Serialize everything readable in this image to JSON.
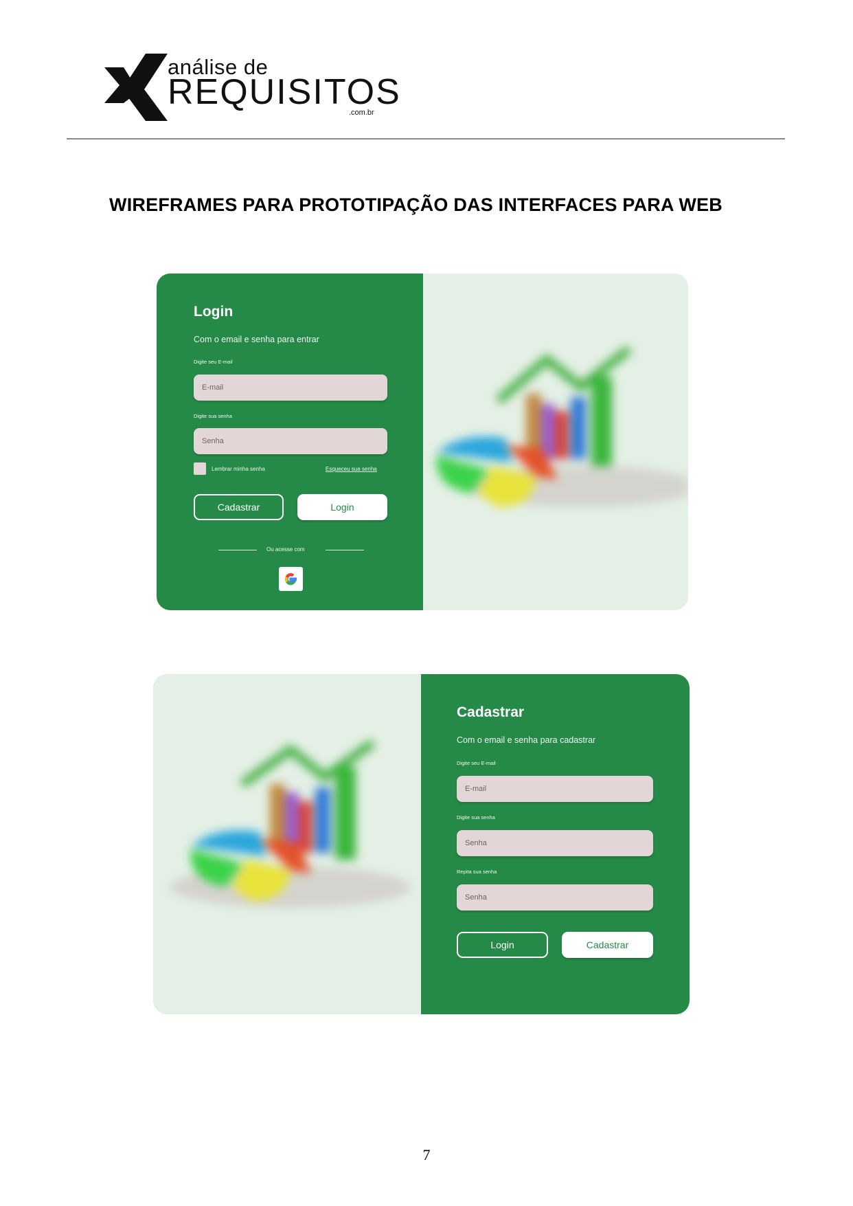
{
  "header": {
    "logo_top": "análise de",
    "logo_main": "REQUISITOS",
    "logo_sub": ".com.br",
    "logo_icon": "x-chevron-logo-icon"
  },
  "title": "WIREFRAMES PARA PROTOTIPAÇÃO DAS INTERFACES PARA WEB",
  "login_screen": {
    "title": "Login",
    "subtitle": "Com o email e senha para entrar",
    "email_label": "Digite seu E-mail",
    "email_placeholder": "E-mail",
    "password_label": "Digite sua senha",
    "password_placeholder": "Senha",
    "remember_label": "Lembrar minha senha",
    "forgot_link": "Esqueceu sua senha",
    "register_button": "Cadastrar",
    "login_button": "Login",
    "alt_access": "Ou acesse com",
    "google_icon": "google-icon"
  },
  "register_screen": {
    "title": "Cadastrar",
    "subtitle": "Com o email e senha para cadastrar",
    "email_label": "Digite seu E-mail",
    "email_placeholder": "E-mail",
    "password_label": "Digite sua senha",
    "password_placeholder": "Senha",
    "repeat_label": "Repita sua senha",
    "repeat_placeholder": "Senha",
    "login_button": "Login",
    "register_button": "Cadastrar"
  },
  "colors": {
    "panel_green": "#258a48",
    "input_bg": "#e3d6d6",
    "image_bg": "#e4f0e5"
  },
  "page_number": "7"
}
